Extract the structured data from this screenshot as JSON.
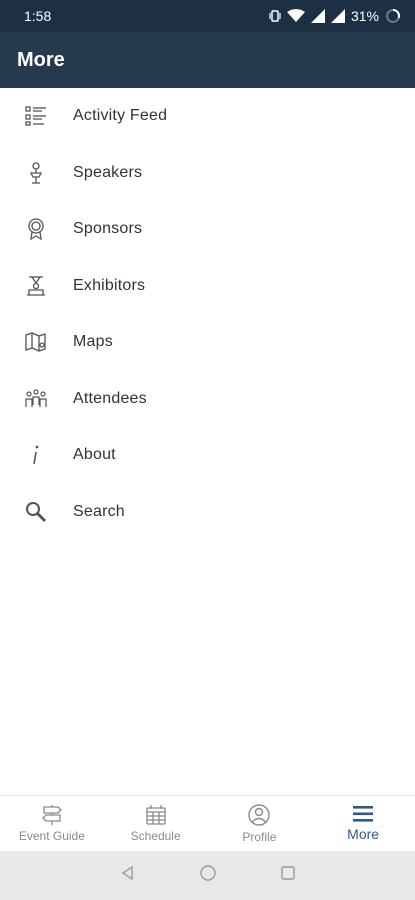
{
  "status_bar": {
    "time": "1:58",
    "battery": "31%"
  },
  "app_bar": {
    "title": "More"
  },
  "menu": {
    "items": [
      {
        "label": "Activity Feed",
        "icon": "activity-feed-icon"
      },
      {
        "label": "Speakers",
        "icon": "speaker-icon"
      },
      {
        "label": "Sponsors",
        "icon": "sponsor-badge-icon"
      },
      {
        "label": "Exhibitors",
        "icon": "exhibitor-booth-icon"
      },
      {
        "label": "Maps",
        "icon": "map-icon"
      },
      {
        "label": "Attendees",
        "icon": "attendees-icon"
      },
      {
        "label": "About",
        "icon": "info-icon"
      },
      {
        "label": "Search",
        "icon": "search-icon"
      }
    ]
  },
  "bottom_nav": {
    "tabs": [
      {
        "label": "Event Guide",
        "icon": "signpost-icon",
        "active": false
      },
      {
        "label": "Schedule",
        "icon": "calendar-icon",
        "active": false
      },
      {
        "label": "Profile",
        "icon": "profile-icon",
        "active": false
      },
      {
        "label": "More",
        "icon": "hamburger-menu-icon",
        "active": true
      }
    ]
  },
  "colors": {
    "status_bar": "#1d2f42",
    "app_bar": "#263a4e",
    "active_tab": "#2d5a8a",
    "inactive_tab": "#8a8a8a"
  }
}
